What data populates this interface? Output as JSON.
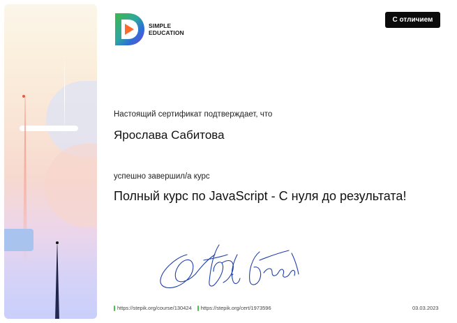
{
  "logo": {
    "brand_line1": "SIMPLE",
    "brand_line2": "EDUCATION",
    "colors": {
      "green": "#3db84a",
      "blue": "#2c6fd8",
      "purple": "#7a3fd0",
      "orange": "#ff6a2b"
    }
  },
  "badge": {
    "label": "С отличием"
  },
  "certificate": {
    "intro": "Настоящий сертификат подтверждает, что",
    "recipient": "Ярослава Сабитова",
    "completed": "успешно завершил/а  курс",
    "course_title": "Полный курс по JavaScript - С нуля до результата!"
  },
  "footer": {
    "course_link": "https://stepik.org/course/130424",
    "cert_link": "https://stepik.org/cert/1973596",
    "date": "03.03.2023",
    "accent": "#45c44b"
  }
}
